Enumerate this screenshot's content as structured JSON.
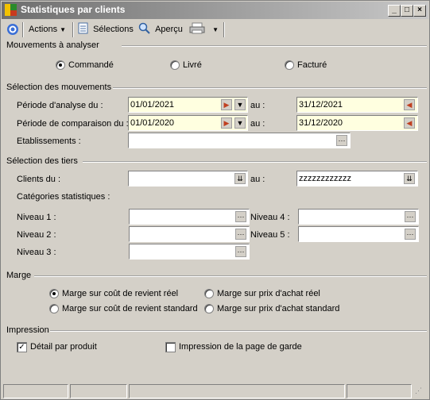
{
  "window": {
    "title": "Statistiques par clients"
  },
  "toolbar": {
    "actions": "Actions",
    "selections": "Sélections",
    "apercu": "Aperçu"
  },
  "mouvements": {
    "title": "Mouvements à analyser",
    "options": [
      "Commandé",
      "Livré",
      "Facturé"
    ],
    "selected": "Commandé"
  },
  "selection_mouvements": {
    "title": "Sélection des mouvements",
    "periode_analyse_label": "Période d'analyse du :",
    "periode_analyse_from": "01/01/2021",
    "periode_analyse_to": "31/12/2021",
    "periode_comparaison_label": "Période de comparaison du :",
    "periode_comparaison_from": "01/01/2020",
    "periode_comparaison_to": "31/12/2020",
    "au_label": "au :",
    "etablissements_label": "Etablissements :",
    "etablissements_value": ""
  },
  "selection_tiers": {
    "title": "Sélection des tiers",
    "clients_label": "Clients du :",
    "clients_from": "",
    "clients_to": "zzzzzzzzzzzz",
    "au_label": "au :",
    "categories_label": "Catégories statistiques :",
    "niveau1_label": "Niveau 1 :",
    "niveau2_label": "Niveau 2 :",
    "niveau3_label": "Niveau 3 :",
    "niveau4_label": "Niveau 4 :",
    "niveau5_label": "Niveau 5 :"
  },
  "marge": {
    "title": "Marge",
    "opt1": "Marge sur coût de revient réel",
    "opt2": "Marge sur prix d'achat réel",
    "opt3": "Marge sur coût de revient standard",
    "opt4": "Marge sur prix d'achat standard",
    "selected": "Marge sur coût de revient réel"
  },
  "impression": {
    "title": "Impression",
    "detail_label": "Détail par produit",
    "detail_checked": true,
    "page_garde_label": "Impression de la page de garde",
    "page_garde_checked": false
  }
}
